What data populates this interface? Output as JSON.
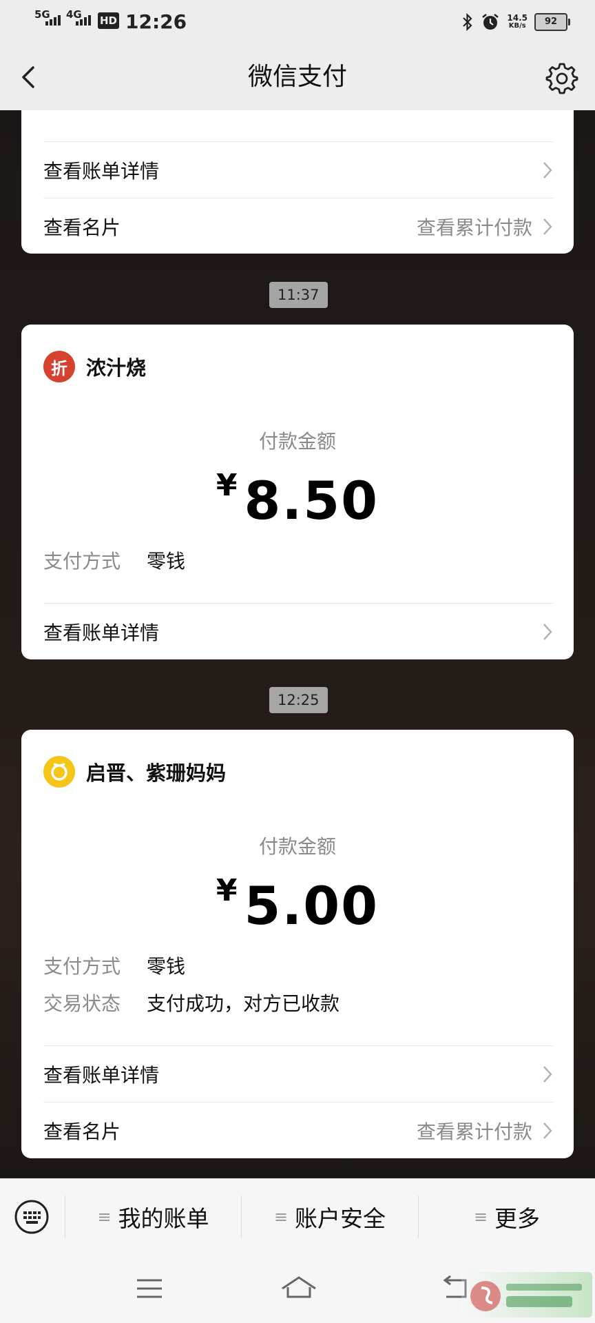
{
  "status_bar": {
    "net1": "5G",
    "net2": "4G",
    "hd": "HD",
    "time": "12:26",
    "speed_value": "14.5",
    "speed_unit": "KB/s",
    "battery": "92"
  },
  "header": {
    "title": "微信支付"
  },
  "card_top": {
    "bill_detail_label": "查看账单详情",
    "card_label": "查看名片",
    "card_hint": "查看累计付款"
  },
  "message_1": {
    "time": "11:37",
    "merchant_name": "浓汁烧",
    "merchant_logo_char": "折",
    "amount_label": "付款金额",
    "currency": "¥",
    "amount": "8.50",
    "payment_method_label": "支付方式",
    "payment_method_value": "零钱",
    "bill_detail_label": "查看账单详情"
  },
  "message_2": {
    "time": "12:25",
    "merchant_name": "启晋、紫珊妈妈",
    "amount_label": "付款金额",
    "currency": "¥",
    "amount": "5.00",
    "payment_method_label": "支付方式",
    "payment_method_value": "零钱",
    "status_label": "交易状态",
    "status_value": "支付成功，对方已收款",
    "bill_detail_label": "查看账单详情",
    "card_label": "查看名片",
    "card_hint": "查看累计付款"
  },
  "bottom_menu": {
    "items": [
      {
        "label": "我的账单"
      },
      {
        "label": "账户安全"
      },
      {
        "label": "更多"
      }
    ]
  },
  "colors": {
    "logo_red": "#d6422f",
    "logo_yellow": "#f5c518",
    "chevron": "#b2b2b2"
  }
}
